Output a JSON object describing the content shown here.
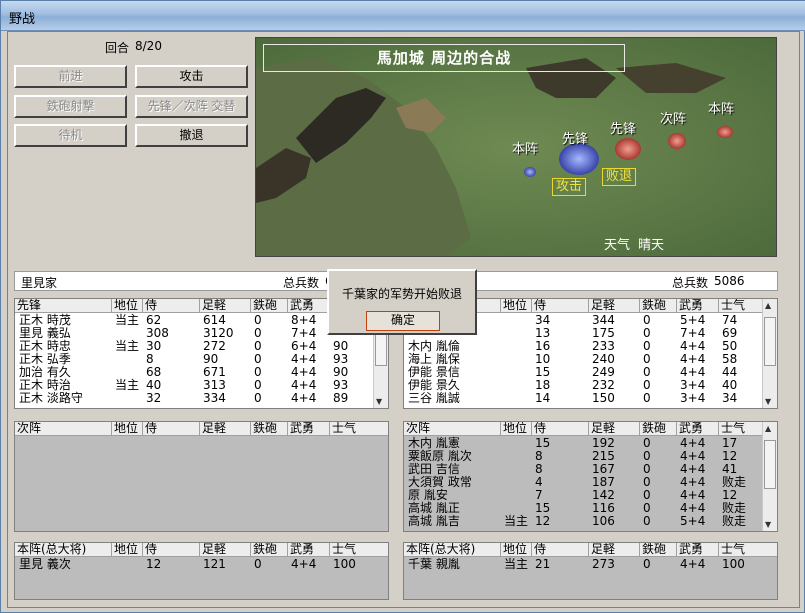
{
  "window": {
    "title": "野战"
  },
  "round": {
    "label": "回合",
    "value": "8/20"
  },
  "buttons": {
    "advance": "前进",
    "attack": "攻击",
    "gun": "鉄砲射撃",
    "swap": "先锋／次阵 交替",
    "wait": "待机",
    "retreat": "撤退"
  },
  "battle": {
    "title": "馬加城  周边的合战",
    "left_honjin": "本阵",
    "left_senpo": "先锋",
    "right_senpo": "先锋",
    "right_jijin": "次阵",
    "right_honjin": "本阵",
    "tag_attack": "攻击",
    "tag_defeat": "败退",
    "weather_label": "天气",
    "weather_value": "晴天"
  },
  "left_army": {
    "name": "里見家",
    "total_label": "总兵数",
    "total_value": "6"
  },
  "right_army": {
    "total_label": "总兵数",
    "total_value": "5086"
  },
  "columns": {
    "pos": "地位",
    "samurai": "侍",
    "ashigaru": "足軽",
    "gun": "鉄砲",
    "valor": "武勇",
    "morale": "士气"
  },
  "left_senpo": {
    "heading": "先锋",
    "rows": [
      {
        "name": "正木 時茂",
        "pos": "当主",
        "sam": "62",
        "ash": "614",
        "gun": "0",
        "val": "8+4",
        "mor": ""
      },
      {
        "name": "里見 義弘",
        "pos": "",
        "sam": "308",
        "ash": "3120",
        "gun": "0",
        "val": "7+4",
        "mor": ""
      },
      {
        "name": "正木 時忠",
        "pos": "当主",
        "sam": "30",
        "ash": "272",
        "gun": "0",
        "val": "6+4",
        "mor": "90"
      },
      {
        "name": "正木 弘季",
        "pos": "",
        "sam": "8",
        "ash": "90",
        "gun": "0",
        "val": "4+4",
        "mor": "93"
      },
      {
        "name": "加治 有久",
        "pos": "",
        "sam": "68",
        "ash": "671",
        "gun": "0",
        "val": "4+4",
        "mor": "90"
      },
      {
        "name": "正木 時治",
        "pos": "当主",
        "sam": "40",
        "ash": "313",
        "gun": "0",
        "val": "4+4",
        "mor": "93"
      },
      {
        "name": "正木 淡路守",
        "pos": "",
        "sam": "32",
        "ash": "334",
        "gun": "0",
        "val": "4+4",
        "mor": "89"
      }
    ]
  },
  "right_senpo": {
    "rows": [
      {
        "name": "",
        "pos": "",
        "sam": "34",
        "ash": "344",
        "gun": "0",
        "val": "5+4",
        "mor": "74"
      },
      {
        "name": "",
        "pos": "",
        "sam": "13",
        "ash": "175",
        "gun": "0",
        "val": "7+4",
        "mor": "69"
      },
      {
        "name": "木内 胤倫",
        "pos": "",
        "sam": "16",
        "ash": "233",
        "gun": "0",
        "val": "4+4",
        "mor": "50"
      },
      {
        "name": "海上 胤保",
        "pos": "",
        "sam": "10",
        "ash": "240",
        "gun": "0",
        "val": "4+4",
        "mor": "58"
      },
      {
        "name": "伊能 景信",
        "pos": "",
        "sam": "15",
        "ash": "249",
        "gun": "0",
        "val": "4+4",
        "mor": "44"
      },
      {
        "name": "伊能 景久",
        "pos": "",
        "sam": "18",
        "ash": "232",
        "gun": "0",
        "val": "3+4",
        "mor": "40"
      },
      {
        "name": "三谷 胤誠",
        "pos": "",
        "sam": "14",
        "ash": "150",
        "gun": "0",
        "val": "3+4",
        "mor": "34"
      }
    ]
  },
  "left_jijin": {
    "heading": "次阵",
    "rows": []
  },
  "right_jijin": {
    "heading": "次阵",
    "rows": [
      {
        "name": "木内 胤憲",
        "pos": "",
        "sam": "15",
        "ash": "192",
        "gun": "0",
        "val": "4+4",
        "mor": "17"
      },
      {
        "name": "粟飯原 胤次",
        "pos": "",
        "sam": "8",
        "ash": "215",
        "gun": "0",
        "val": "4+4",
        "mor": "12"
      },
      {
        "name": "武田 吉信",
        "pos": "",
        "sam": "8",
        "ash": "167",
        "gun": "0",
        "val": "4+4",
        "mor": "41"
      },
      {
        "name": "大須賀 政常",
        "pos": "",
        "sam": "4",
        "ash": "187",
        "gun": "0",
        "val": "4+4",
        "mor": "败走"
      },
      {
        "name": "原 胤安",
        "pos": "",
        "sam": "7",
        "ash": "142",
        "gun": "0",
        "val": "4+4",
        "mor": "12"
      },
      {
        "name": "高城 胤正",
        "pos": "",
        "sam": "15",
        "ash": "116",
        "gun": "0",
        "val": "4+4",
        "mor": "败走"
      },
      {
        "name": "高城 胤吉",
        "pos": "当主",
        "sam": "12",
        "ash": "106",
        "gun": "0",
        "val": "5+4",
        "mor": "败走"
      }
    ]
  },
  "left_honjin": {
    "heading": "本阵(总大将)",
    "rows": [
      {
        "name": "里見 義次",
        "pos": "",
        "sam": "12",
        "ash": "121",
        "gun": "0",
        "val": "4+4",
        "mor": "100"
      }
    ]
  },
  "right_honjin": {
    "heading": "本阵(总大将)",
    "rows": [
      {
        "name": "千葉 親胤",
        "pos": "当主",
        "sam": "21",
        "ash": "273",
        "gun": "0",
        "val": "4+4",
        "mor": "100"
      }
    ]
  },
  "dialog": {
    "message": "千葉家的军势开始败退",
    "ok": "确定"
  }
}
